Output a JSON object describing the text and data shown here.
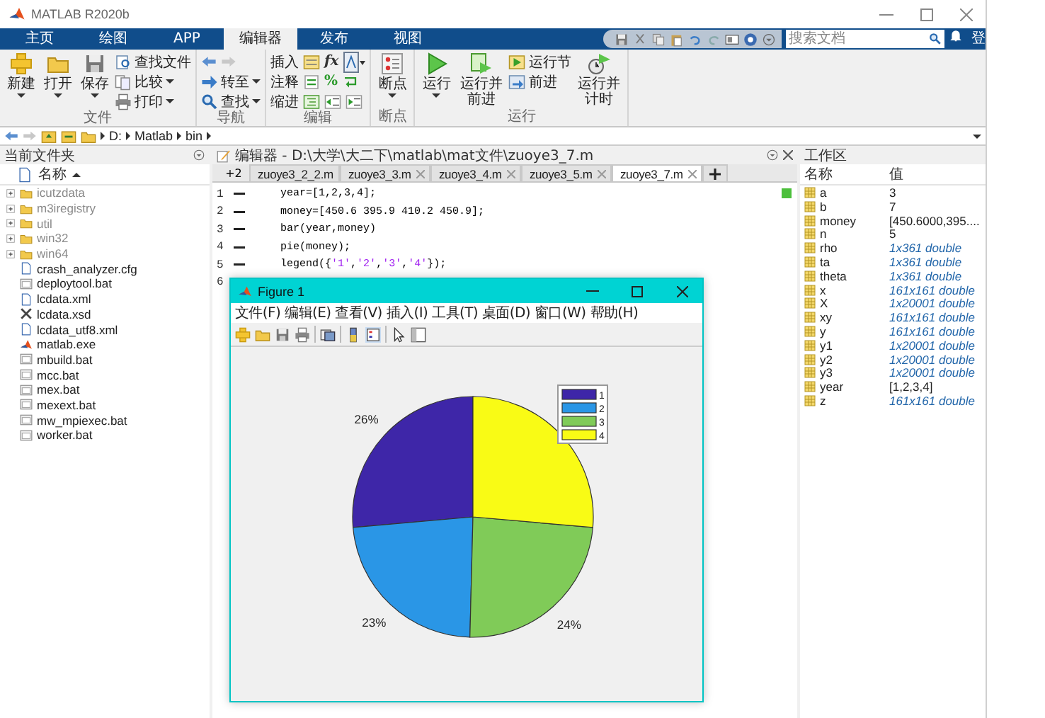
{
  "window": {
    "title": "MATLAB R2020b"
  },
  "tabs": [
    {
      "label": "主页",
      "selected": false
    },
    {
      "label": "绘图",
      "selected": false
    },
    {
      "label": "APP",
      "selected": false
    },
    {
      "label": "编辑器",
      "selected": true
    },
    {
      "label": "发布",
      "selected": false
    },
    {
      "label": "视图",
      "selected": false
    }
  ],
  "search": {
    "placeholder": "搜索文档"
  },
  "sign_in": "登",
  "ribbon": [
    {
      "label": "文件",
      "columns": [
        {
          "kind": "large",
          "label": "新建",
          "menu": true
        },
        {
          "kind": "large",
          "label": "打开",
          "menu": true
        },
        {
          "kind": "large",
          "label": "保存",
          "menu": true
        },
        {
          "kind": "stack",
          "items": [
            {
              "label": "查找文件",
              "menu": false
            },
            {
              "label": "比较",
              "menu": true
            },
            {
              "label": "打印",
              "menu": true
            }
          ]
        }
      ]
    },
    {
      "label": "导航",
      "columns": [
        {
          "kind": "nav",
          "items": [
            {
              "label": "转至",
              "menu": true
            },
            {
              "label": "查找",
              "menu": true
            }
          ]
        }
      ]
    },
    {
      "label": "编辑",
      "columns": [
        {
          "kind": "rows",
          "rows": [
            {
              "label": "插入",
              "symbol": "fx"
            },
            {
              "label": "注释",
              "symbol": "%"
            },
            {
              "label": "缩进"
            }
          ]
        }
      ]
    },
    {
      "label": "断点",
      "columns": [
        {
          "kind": "large",
          "label": "断点",
          "menu": true
        }
      ]
    },
    {
      "label": "运行",
      "columns": [
        {
          "kind": "large",
          "label": "运行",
          "menu": true
        },
        {
          "kind": "large",
          "label": "运行并前进",
          "menu": false
        },
        {
          "kind": "stack",
          "items": [
            {
              "label": "运行节",
              "menu": false
            },
            {
              "label": "前进",
              "menu": false
            }
          ]
        },
        {
          "kind": "large",
          "label": "运行并计时",
          "menu": false
        }
      ]
    }
  ],
  "address": [
    "D:",
    "Matlab",
    "bin"
  ],
  "current_folder": {
    "title": "当前文件夹",
    "column": "名称",
    "items": [
      {
        "name": "icutzdata",
        "kind": "folder"
      },
      {
        "name": "m3iregistry",
        "kind": "folder"
      },
      {
        "name": "util",
        "kind": "folder"
      },
      {
        "name": "win32",
        "kind": "folder"
      },
      {
        "name": "win64",
        "kind": "folder"
      },
      {
        "name": "crash_analyzer.cfg",
        "kind": "file"
      },
      {
        "name": "deploytool.bat",
        "kind": "bat"
      },
      {
        "name": "lcdata.xml",
        "kind": "file"
      },
      {
        "name": "lcdata.xsd",
        "kind": "xsd"
      },
      {
        "name": "lcdata_utf8.xml",
        "kind": "file"
      },
      {
        "name": "matlab.exe",
        "kind": "exe"
      },
      {
        "name": "mbuild.bat",
        "kind": "bat"
      },
      {
        "name": "mcc.bat",
        "kind": "bat"
      },
      {
        "name": "mex.bat",
        "kind": "bat"
      },
      {
        "name": "mexext.bat",
        "kind": "bat"
      },
      {
        "name": "mw_mpiexec.bat",
        "kind": "bat"
      },
      {
        "name": "worker.bat",
        "kind": "bat"
      }
    ]
  },
  "editor": {
    "title": "编辑器 - D:\\大学\\大二下\\matlab\\mat文件\\zuoye3_7.m",
    "overflow": "+2",
    "tabs": [
      {
        "label": "zuoye3_2_2.m",
        "selected": false
      },
      {
        "label": "zuoye3_3.m",
        "selected": false
      },
      {
        "label": "zuoye3_4.m",
        "selected": false
      },
      {
        "label": "zuoye3_5.m",
        "selected": false
      },
      {
        "label": "zuoye3_7.m",
        "selected": true
      }
    ],
    "lines": [
      {
        "number": "1",
        "executable": true,
        "tokens": [
          {
            "text": "year=[1,2,3,4];",
            "kind": "plain"
          }
        ]
      },
      {
        "number": "2",
        "executable": true,
        "tokens": [
          {
            "text": "money=[450.6 395.9 410.2 450.9];",
            "kind": "plain"
          }
        ]
      },
      {
        "number": "3",
        "executable": true,
        "tokens": [
          {
            "text": "bar(year,money)",
            "kind": "plain"
          }
        ]
      },
      {
        "number": "4",
        "executable": true,
        "tokens": [
          {
            "text": "pie(money);",
            "kind": "plain"
          }
        ]
      },
      {
        "number": "5",
        "executable": true,
        "tokens": [
          {
            "text": "legend({",
            "kind": "plain"
          },
          {
            "text": "'1'",
            "kind": "string"
          },
          {
            "text": ",",
            "kind": "plain"
          },
          {
            "text": "'2'",
            "kind": "string"
          },
          {
            "text": ",",
            "kind": "plain"
          },
          {
            "text": "'3'",
            "kind": "string"
          },
          {
            "text": ",",
            "kind": "plain"
          },
          {
            "text": "'4'",
            "kind": "string"
          },
          {
            "text": "});",
            "kind": "plain"
          }
        ]
      },
      {
        "number": "6",
        "executable": false
      }
    ]
  },
  "workspace": {
    "title": "工作区",
    "columns": [
      "名称",
      "值"
    ],
    "rows": [
      {
        "name": "a",
        "value": "3",
        "kind": "value"
      },
      {
        "name": "b",
        "value": "7",
        "kind": "value"
      },
      {
        "name": "money",
        "value": "[450.6000,395....",
        "kind": "value"
      },
      {
        "name": "n",
        "value": "5",
        "kind": "value"
      },
      {
        "name": "rho",
        "value": "1x361 double",
        "kind": "size"
      },
      {
        "name": "ta",
        "value": "1x361 double",
        "kind": "size"
      },
      {
        "name": "theta",
        "value": "1x361 double",
        "kind": "size"
      },
      {
        "name": "x",
        "value": "161x161 double",
        "kind": "size"
      },
      {
        "name": "X",
        "value": "1x20001 double",
        "kind": "size"
      },
      {
        "name": "xy",
        "value": "161x161 double",
        "kind": "size"
      },
      {
        "name": "y",
        "value": "161x161 double",
        "kind": "size"
      },
      {
        "name": "y1",
        "value": "1x20001 double",
        "kind": "size"
      },
      {
        "name": "y2",
        "value": "1x20001 double",
        "kind": "size"
      },
      {
        "name": "y3",
        "value": "1x20001 double",
        "kind": "size"
      },
      {
        "name": "year",
        "value": "[1,2,3,4]",
        "kind": "value"
      },
      {
        "name": "z",
        "value": "161x161 double",
        "kind": "size"
      }
    ]
  },
  "figure": {
    "title": "Figure 1",
    "menus": [
      "文件(F)",
      "编辑(E)",
      "查看(V)",
      "插入(I)",
      "工具(T)",
      "桌面(D)",
      "窗口(W)",
      "帮助(H)"
    ],
    "chart_data": {
      "type": "pie",
      "categories": [
        "1",
        "2",
        "3",
        "4"
      ],
      "series": [
        {
          "values": [
            26.4,
            23.2,
            24.0,
            26.4
          ]
        }
      ],
      "legend": true,
      "colors": [
        "#3e26a8",
        "#2a96e6",
        "#80cb58",
        "#f9fb15"
      ],
      "value_labels": [
        "26%",
        "23%",
        "24%",
        null
      ]
    }
  }
}
